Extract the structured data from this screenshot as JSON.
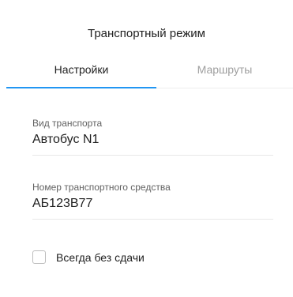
{
  "header": {
    "title": "Транспортный режим"
  },
  "tabs": [
    {
      "label": "Настройки",
      "active": true
    },
    {
      "label": "Маршруты",
      "active": false
    }
  ],
  "colors": {
    "accent": "#2196f3",
    "inactive_tab": "#9e9e9e"
  },
  "fields": [
    {
      "label": "Вид транспорта",
      "value": "Автобус N1"
    },
    {
      "label": "Номер транспортного средства",
      "value": "АБ123В77"
    }
  ],
  "options": {
    "no_change": {
      "label": "Всегда без сдачи",
      "checked": false
    }
  }
}
